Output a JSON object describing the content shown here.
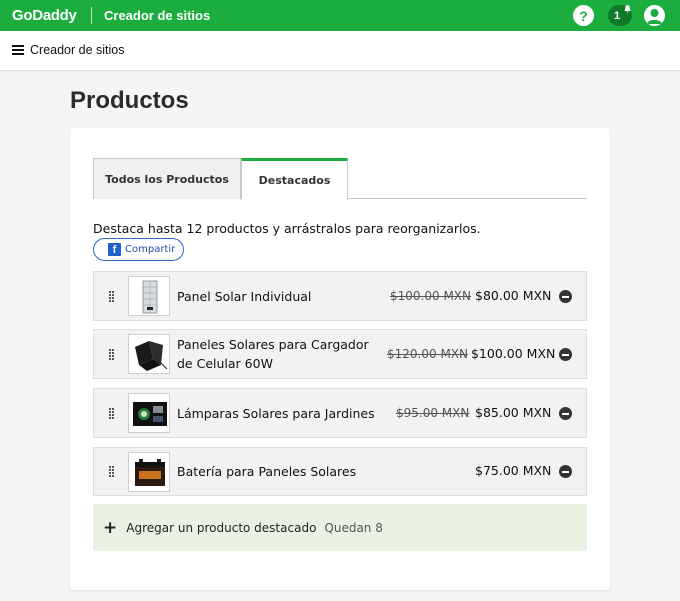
{
  "topbar": {
    "logo": "GoDaddy",
    "app_title": "Creador de sitios",
    "help_label": "?",
    "notification_count": "1"
  },
  "subbar": {
    "title": "Creador de sitios"
  },
  "page": {
    "title": "Productos"
  },
  "tabs": [
    {
      "label": "Todos los Productos",
      "active": false
    },
    {
      "label": "Destacados",
      "active": true
    }
  ],
  "description": "Destaca hasta 12 productos y arrástralos para reorganizarlos.",
  "share_button": {
    "icon": "facebook-icon",
    "label": "Compartir"
  },
  "products": [
    {
      "name": "Panel Solar Individual",
      "old_price": "$100.00 MXN",
      "price": "$80.00 MXN",
      "thumb": "solar-panel"
    },
    {
      "name": "Paneles Solares para Cargador de Celular 60W",
      "old_price": "$120.00 MXN",
      "price": "$100.00 MXN",
      "thumb": "folding-panel"
    },
    {
      "name": "Lámparas Solares para Jardines",
      "old_price": "$95.00 MXN",
      "price": "$85.00 MXN",
      "thumb": "garden-lamp"
    },
    {
      "name": "Batería para Paneles Solares",
      "old_price": "",
      "price": "$75.00 MXN",
      "thumb": "battery"
    }
  ],
  "add_featured": {
    "label": "Agregar un producto destacado",
    "remaining": "Quedan 8"
  },
  "colors": {
    "brand": "#1bae3e",
    "add_row_bg": "#e9f2e2"
  }
}
